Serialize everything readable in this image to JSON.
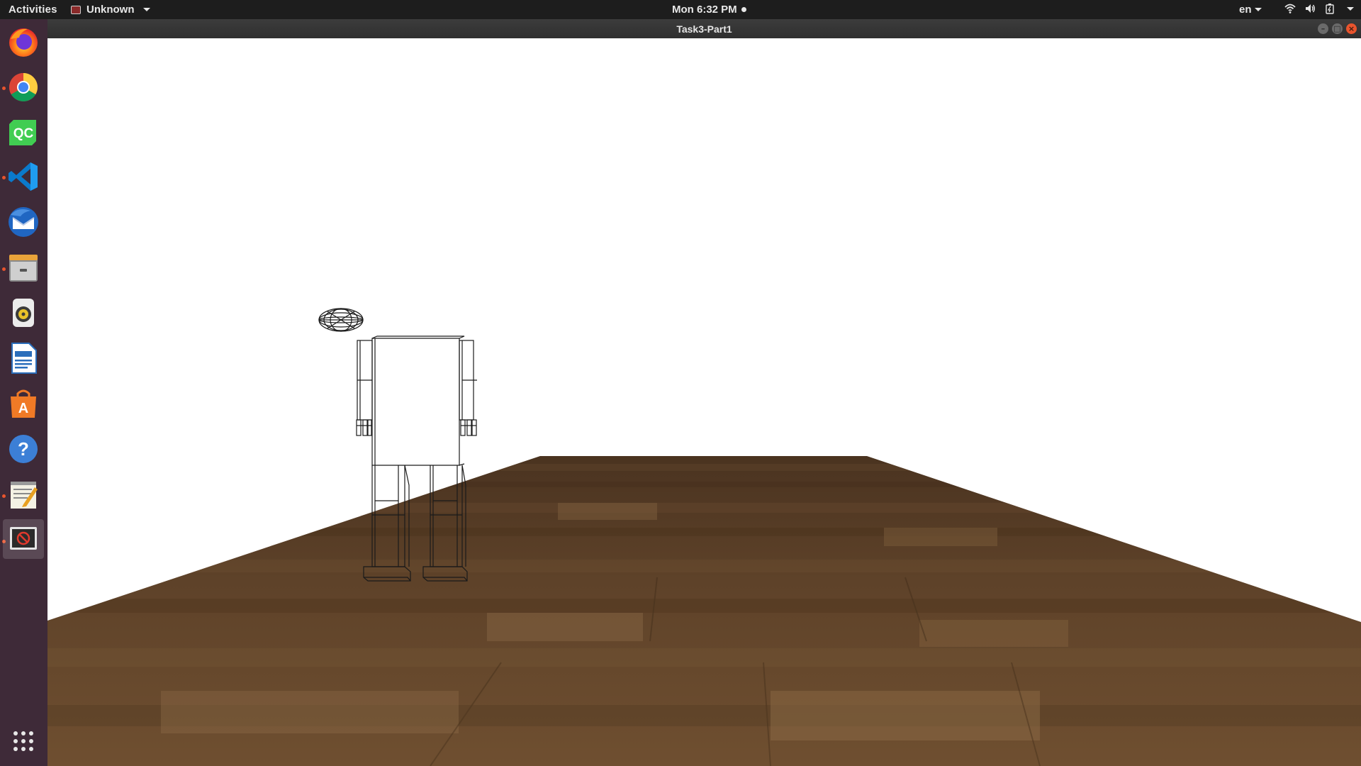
{
  "topbar": {
    "activities_label": "Activities",
    "app_menu_label": "Unknown",
    "clock_label": "Mon  6:32 PM",
    "language_label": "en",
    "status_icons": [
      "wifi-icon",
      "volume-icon",
      "battery-icon",
      "chevron-down-icon"
    ]
  },
  "window": {
    "title": "Task3-Part1",
    "controls": [
      "minimize-icon",
      "maximize-icon",
      "close-icon"
    ]
  },
  "dock": {
    "background": "#3e2a38",
    "items": [
      {
        "name": "firefox",
        "running": false
      },
      {
        "name": "chrome",
        "running": true
      },
      {
        "name": "qt-creator",
        "running": false
      },
      {
        "name": "vscode",
        "running": true
      },
      {
        "name": "thunderbird",
        "running": false
      },
      {
        "name": "files",
        "running": true
      },
      {
        "name": "rhythmbox",
        "running": false
      },
      {
        "name": "libreoffice-writer",
        "running": false
      },
      {
        "name": "ubuntu-software",
        "running": false
      },
      {
        "name": "help",
        "running": false
      },
      {
        "name": "text-editor",
        "running": true
      },
      {
        "name": "opengl-app",
        "running": true,
        "active": true
      }
    ],
    "show_apps_icon": "grid-icon"
  },
  "scene": {
    "sky_color": "#ffffff",
    "floor_color": "#6b4a2c",
    "model": "wireframe-humanoid"
  }
}
